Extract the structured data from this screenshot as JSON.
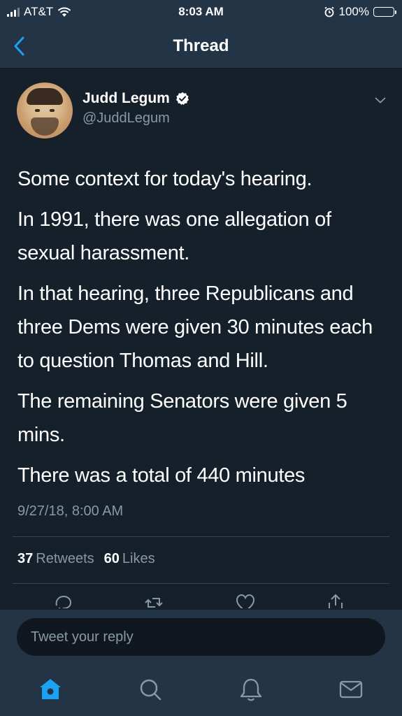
{
  "status_bar": {
    "carrier": "AT&T",
    "time": "8:03 AM",
    "battery_percent": "100%"
  },
  "nav": {
    "title": "Thread",
    "back_icon": "chevron-left-icon"
  },
  "tweet": {
    "author_name": "Judd Legum",
    "author_handle": "@JuddLegum",
    "verified": true,
    "paragraphs": [
      "Some context for today's hearing.",
      "In 1991, there was one allegation of sexual harassment.",
      "In that hearing, three Republicans and three Dems were given 30 minutes each to question Thomas and Hill.",
      "The remaining Senators were given 5 mins.",
      "There was a total of 440 minutes"
    ],
    "timestamp": "9/27/18, 8:00 AM",
    "retweets_count": "37",
    "retweets_label": "Retweets",
    "likes_count": "60",
    "likes_label": "Likes"
  },
  "reply": {
    "placeholder": "Tweet your reply"
  },
  "tabs": [
    {
      "name": "home",
      "icon": "home-icon",
      "active": true
    },
    {
      "name": "search",
      "icon": "search-icon",
      "active": false
    },
    {
      "name": "notifications",
      "icon": "bell-icon",
      "active": false
    },
    {
      "name": "messages",
      "icon": "mail-icon",
      "active": false
    }
  ],
  "colors": {
    "background": "#15202b",
    "bar": "#243447",
    "accent": "#1da1f2",
    "muted": "#8899a6"
  }
}
